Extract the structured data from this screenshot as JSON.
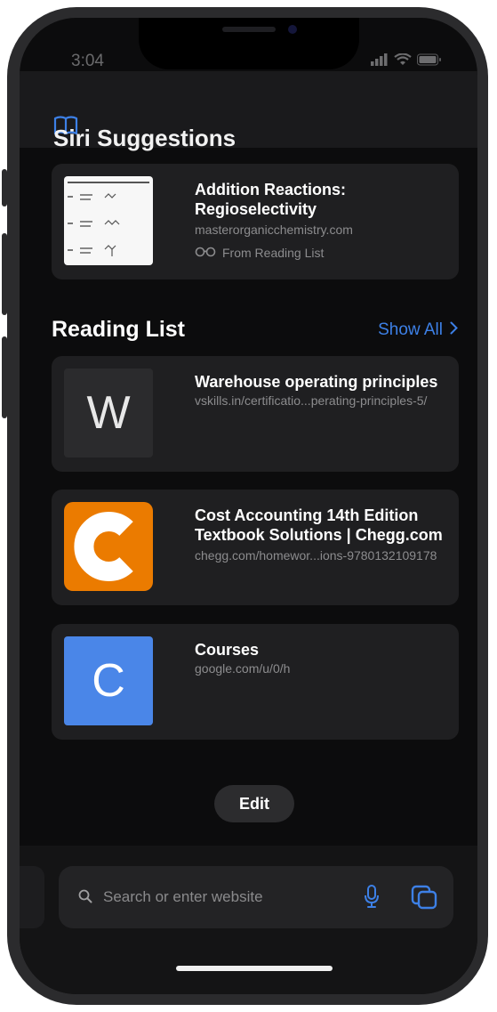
{
  "status": {
    "time": "3:04"
  },
  "header": {
    "partial_section_title": "Siri Suggestions"
  },
  "siri_suggestion": {
    "title": "Addition Reactions: Regioselectivity",
    "url": "masterorganicchemistry.com",
    "source": "From Reading List"
  },
  "reading_list": {
    "title": "Reading List",
    "show_all": "Show All",
    "items": [
      {
        "letter": "W",
        "title": "Warehouse operating principles",
        "url": "vskills.in/certificatio...perating-principles-5/",
        "thumb_bg": "#2b2b2d"
      },
      {
        "letter": "C",
        "title": "Cost Accounting 14th Edition Textbook Solutions | Chegg.com",
        "url": "chegg.com/homewor...ions-9780132109178",
        "thumb_bg": "#eb7b00"
      },
      {
        "letter": "C",
        "title": "Courses",
        "url": "google.com/u/0/h",
        "thumb_bg": "#4a86e8"
      }
    ]
  },
  "edit_label": "Edit",
  "search": {
    "placeholder": "Search or enter website"
  },
  "icons": {
    "book": "book-icon",
    "search": "search-icon",
    "mic": "microphone-icon",
    "tabs": "tabs-icon",
    "reading_list_glasses": "glasses-icon"
  },
  "colors": {
    "accent": "#3d80e6",
    "background": "#0c0c0d",
    "card": "#1f1f21"
  }
}
